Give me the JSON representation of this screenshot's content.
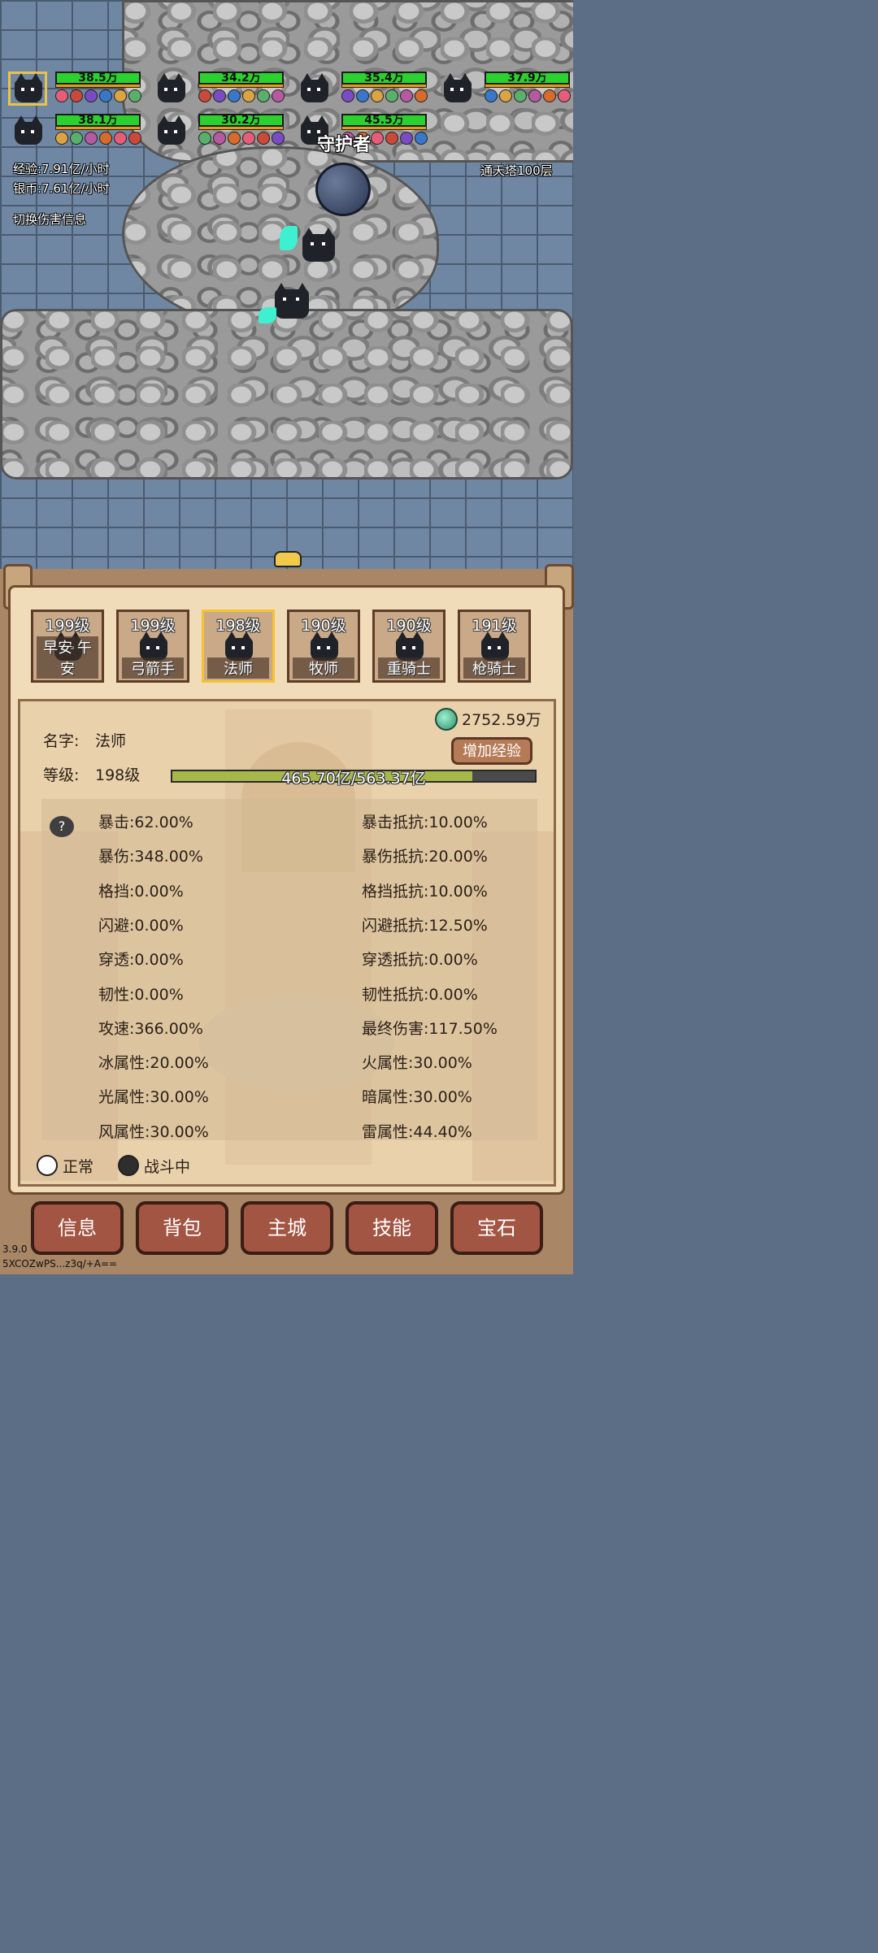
{
  "field": {
    "team_units": [
      {
        "hp": "38.5万",
        "selected": true
      },
      {
        "hp": "34.2万"
      },
      {
        "hp": "35.4万"
      },
      {
        "hp": "37.9万"
      },
      {
        "hp": "38.1万"
      },
      {
        "hp": "30.2万"
      },
      {
        "hp": "45.5万"
      }
    ],
    "enemy_label": "守护者",
    "exp_rate": "经验:7.91亿/小时",
    "silver_rate": "银币:7.61亿/小时",
    "toggle_damage": "切换伤害信息",
    "stage": "通天塔100层"
  },
  "heroes": [
    {
      "level": "199级",
      "name": "早安 午安",
      "active": false
    },
    {
      "level": "199级",
      "name": "弓箭手",
      "active": false
    },
    {
      "level": "198级",
      "name": "法师",
      "active": true
    },
    {
      "level": "190级",
      "name": "牧师",
      "active": false
    },
    {
      "level": "190级",
      "name": "重骑士",
      "active": false
    },
    {
      "level": "191级",
      "name": "枪骑士",
      "active": false
    }
  ],
  "info": {
    "currency": "2752.59万",
    "name_label": "名字:",
    "name_value": "法师",
    "add_exp": "增加经验",
    "level_label": "等级:",
    "level_value": "198级",
    "exp_text": "465.70亿/563.37亿",
    "exp_fraction": 0.8266,
    "help": "?"
  },
  "stats_left": [
    "暴击:62.00%",
    "暴伤:348.00%",
    "格挡:0.00%",
    "闪避:0.00%",
    "穿透:0.00%",
    "韧性:0.00%",
    "攻速:366.00%",
    "冰属性:20.00%",
    "光属性:30.00%",
    "风属性:30.00%"
  ],
  "stats_right": [
    "暴击抵抗:10.00%",
    "暴伤抵抗:20.00%",
    "格挡抵抗:10.00%",
    "闪避抵抗:12.50%",
    "穿透抵抗:0.00%",
    "韧性抵抗:0.00%",
    "最终伤害:117.50%",
    "火属性:30.00%",
    "暗属性:30.00%",
    "雷属性:44.40%"
  ],
  "legend": {
    "normal": "正常",
    "battle": "战斗中"
  },
  "nav": [
    "信息",
    "背包",
    "主城",
    "技能",
    "宝石"
  ],
  "version": "3.9.0",
  "build_id": "5XCOZwPS...z3q/+A==",
  "colors": {
    "hp": "#2bd12e",
    "mp": "#e79b18",
    "selected": "#f6c232",
    "nav": "#a25543"
  }
}
